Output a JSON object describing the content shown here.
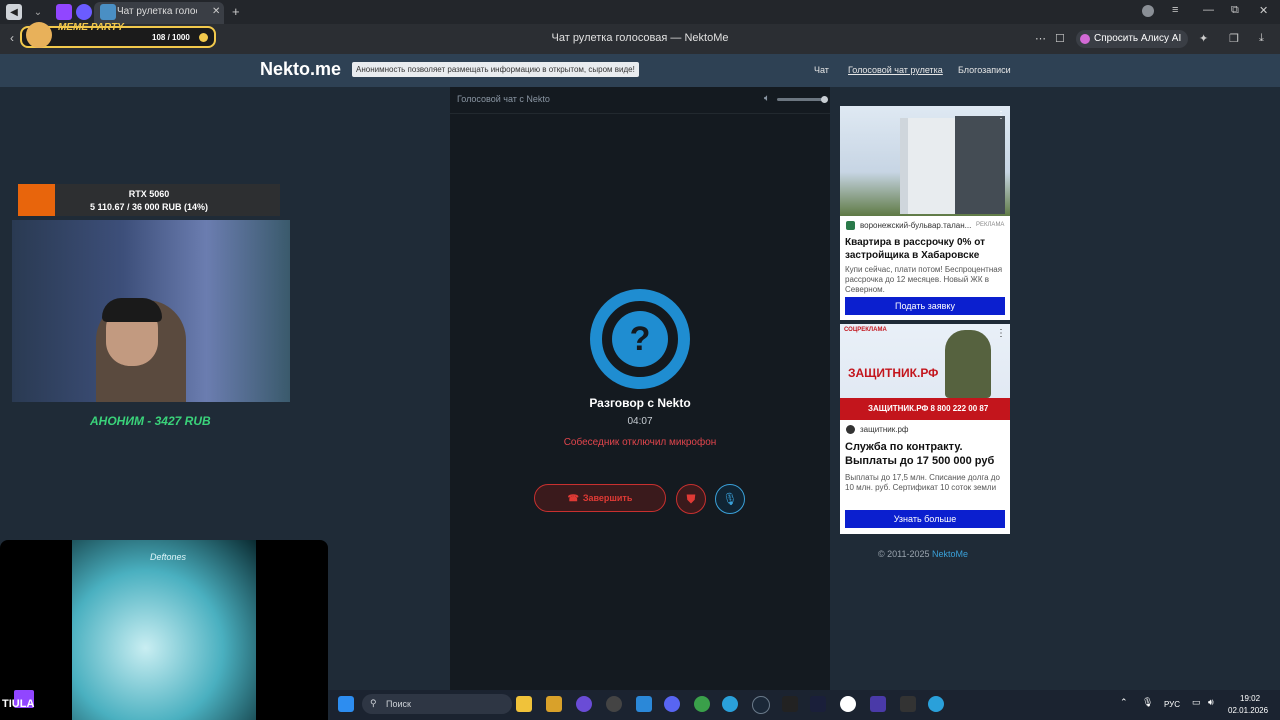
{
  "browser": {
    "tab_title": "Чат рулетка голосо",
    "page_title": "Чат рулетка голосовая — NektoMe",
    "ask_ai": "Спросить Алису AI"
  },
  "site": {
    "logo": "Nekto.me",
    "notice": "Анонимность позволяет размещать информацию в открытом, сыром виде!",
    "nav": [
      "Чат",
      "Голосовой чат рулетка",
      "Блогозаписи"
    ]
  },
  "chat": {
    "header": "Голосовой чат с Nekto",
    "avatar_glyph": "?",
    "title": "Разговор с Nekto",
    "timer": "04:07",
    "status": "Собеседник отключил микрофон",
    "end_label": "Завершить"
  },
  "ads": [
    {
      "domain": "воронежский-бульвар.талан...",
      "tag": "РЕКЛАМА",
      "title": "Квартира в рассрочку 0% от застройщика в Хабаровске",
      "desc": "Купи сейчас, плати потом! Беспроцентная рассрочка до 12 месяцев. Новый ЖК в Северном.",
      "button": "Подать заявку"
    },
    {
      "banner_tag": "СОЦРЕКЛАМА",
      "banner_brand": "ЗАЩИТНИК.РФ",
      "banner_phone": "ЗАЩИТНИК.РФ  8 800 222 00 87",
      "domain": "защитник.рф",
      "title": "Служба по контракту. Выплаты до 17 500 000 руб",
      "desc": "Выплаты до 17,5 млн. Списание долга до 10 млн. руб. Сертификат 10 соток земли",
      "button": "Узнать больше"
    }
  ],
  "footer": {
    "copyright": "© 2011-2025 ",
    "link": "NektoMe"
  },
  "stream": {
    "goal_title": "RTX 5060",
    "goal_progress": "5 110.67 / 36 000 RUB (14%)",
    "goal_fraction": 0.14,
    "donor": "АНОНИМ - 3427 RUB",
    "album_text": "Deftones",
    "brand": "TIULA",
    "meme_title": "MEME PARTY",
    "meme_progress": "108 / 1000"
  },
  "taskbar": {
    "search": "Поиск",
    "lang": "РУС",
    "time": "19:02",
    "date": "02.01.2026"
  },
  "colors": {
    "accent": "#1f8dd1",
    "danger": "#e03a35",
    "ad_button": "#0b1fcf"
  }
}
